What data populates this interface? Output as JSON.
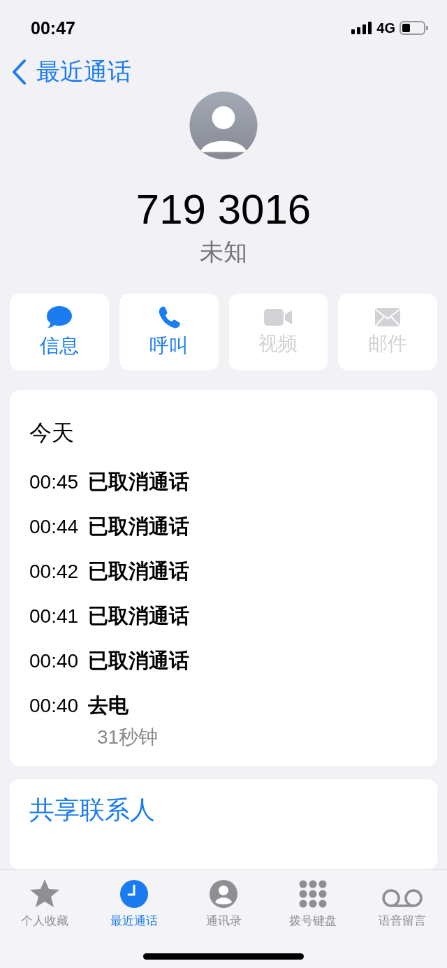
{
  "status_bar": {
    "time": "00:47",
    "network": "4G"
  },
  "nav": {
    "back_label": "最近通话"
  },
  "contact": {
    "number": "719 3016",
    "label": "未知"
  },
  "actions": [
    {
      "kind": "message",
      "label": "信息",
      "disabled": false
    },
    {
      "kind": "call",
      "label": "呼叫",
      "disabled": false
    },
    {
      "kind": "video",
      "label": "视频",
      "disabled": true
    },
    {
      "kind": "mail",
      "label": "邮件",
      "disabled": true
    }
  ],
  "call_log": {
    "day": "今天",
    "entries": [
      {
        "time": "00:45",
        "type": "已取消通话"
      },
      {
        "time": "00:44",
        "type": "已取消通话"
      },
      {
        "time": "00:42",
        "type": "已取消通话"
      },
      {
        "time": "00:41",
        "type": "已取消通话"
      },
      {
        "time": "00:40",
        "type": "已取消通话"
      },
      {
        "time": "00:40",
        "type": "去电",
        "duration": "31秒钟"
      }
    ]
  },
  "share_contact": "共享联系人",
  "tabs": [
    {
      "kind": "favorites",
      "label": "个人收藏",
      "selected": false
    },
    {
      "kind": "recents",
      "label": "最近通话",
      "selected": true
    },
    {
      "kind": "contacts",
      "label": "通讯录",
      "selected": false
    },
    {
      "kind": "keypad",
      "label": "拨号键盘",
      "selected": false
    },
    {
      "kind": "voicemail",
      "label": "语音留言",
      "selected": false
    }
  ]
}
